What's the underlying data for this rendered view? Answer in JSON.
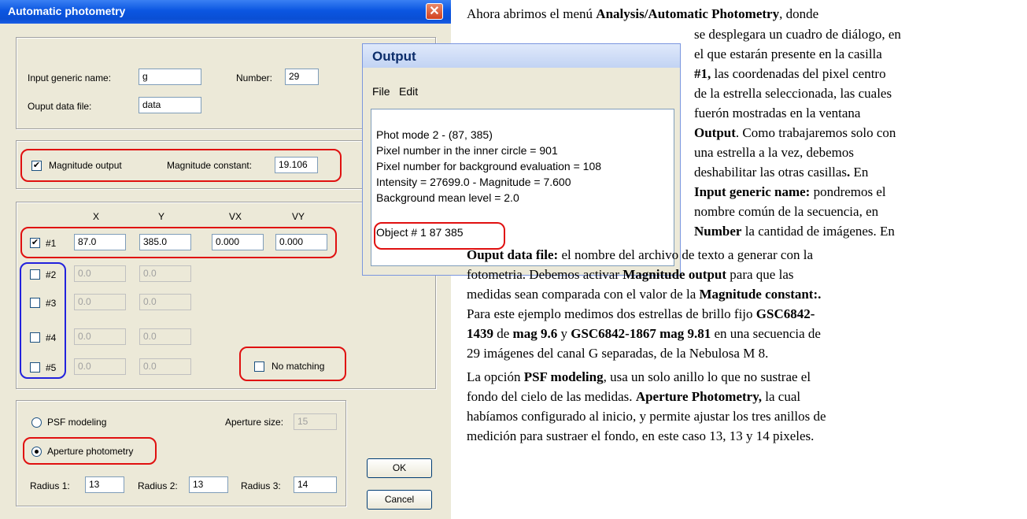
{
  "dialog": {
    "title": "Automatic photometry",
    "close_glyph": "✕",
    "input_generic_name_label": "Input generic name:",
    "input_generic_name_value": "g",
    "number_label": "Number:",
    "number_value": "29",
    "output_file_label": "Ouput data file:",
    "output_file_value": "data",
    "magnitude_output_label": "Magnitude output",
    "magnitude_output_checked": true,
    "magnitude_constant_label": "Magnitude constant:",
    "magnitude_constant_value": "19.106",
    "col_headers": [
      "X",
      "Y",
      "VX",
      "VY"
    ],
    "rows": [
      {
        "label": "#1",
        "checked": true,
        "x": "87.0",
        "y": "385.0",
        "vx": "0.000",
        "vy": "0.000"
      },
      {
        "label": "#2",
        "checked": false,
        "x": "0.0",
        "y": "0.0"
      },
      {
        "label": "#3",
        "checked": false,
        "x": "0.0",
        "y": "0.0"
      },
      {
        "label": "#4",
        "checked": false,
        "x": "0.0",
        "y": "0.0"
      },
      {
        "label": "#5",
        "checked": false,
        "x": "0.0",
        "y": "0.0"
      }
    ],
    "no_matching_label": "No matching",
    "psf_label": "PSF modeling",
    "aperture_size_label": "Aperture size:",
    "aperture_size_value": "15",
    "aperture_photometry_label": "Aperture photometry",
    "radius1_label": "Radius 1:",
    "radius1_value": "13",
    "radius2_label": "Radius 2:",
    "radius2_value": "13",
    "radius3_label": "Radius 3:",
    "radius3_value": "14",
    "ok_label": "OK",
    "cancel_label": "Cancel"
  },
  "output_window": {
    "title": "Output",
    "menu": [
      "File",
      "Edit"
    ],
    "lines": [
      "Phot mode 2  -  (87,    385)",
      "Pixel number in the inner circle = 901",
      "Pixel number for background evaluation = 108",
      "Intensity = 27699.0  -  Magnitude = 7.600",
      "Background mean level = 2.0"
    ],
    "object_line": "Object # 1    87     385"
  },
  "text": {
    "l1a": "Ahora abrimos el menú ",
    "l1b": "Analysis/Automatic Photometry",
    "l1c": ", donde",
    "l2": "se desplegara un cuadro de diálogo, en",
    "l3": "el que estarán presente en la casilla",
    "l4a": "#1,",
    "l4b": " las coordenadas del pixel centro",
    "l5": "de la estrella seleccionada, las cuales",
    "l6": "fuerón   mostradas   en   la   ventana",
    "l7a": "Output",
    "l7b": ". Como trabajaremos solo con",
    "l8": "una   estrella   a   la   vez,   debemos",
    "l9a": "deshabilitar las otras casillas",
    "l9b": ".",
    "l9c": " En",
    "l10a": "Input generic name:",
    "l10b": " pondremos el",
    "l11": "nombre común de la secuencia, en",
    "l12a": "Number",
    "l12b": " la cantidad de imágenes. En",
    "l13a": "Ouput data file:",
    "l13b": " el nombre del archivo de texto a generar con la",
    "l14a": "fotometria. Debemos activar ",
    "l14b": "Magnitude output",
    "l14c": " para que las",
    "l15a": "medidas sean comparada con el valor de la ",
    "l15b": "Magnitude constant:.",
    "l16a": "Para este ejemplo medimos dos estrellas de brillo fijo ",
    "l16b": "GSC6842-",
    "l17a": "1439",
    "l17b": " de ",
    "l17c": "mag 9.6",
    "l17d": " y ",
    "l17e": "GSC6842-1867 mag 9.81",
    "l17f": " en una secuencia de",
    "l18": "29 imágenes del canal G separadas, de la Nebulosa M 8.",
    "l19a": "La opción ",
    "l19b": "PSF modeling",
    "l19c": ", usa un solo anillo lo que no sustrae el",
    "l20": "fondo del cielo de las medidas. ",
    "l20b": "Aperture Photometry,",
    "l20c": " la cual",
    "l21": "habíamos configurado al inicio, y permite ajustar los tres anillos de",
    "l22": "medición para sustraer el fondo, en este caso 13, 13 y 14 pixeles."
  }
}
